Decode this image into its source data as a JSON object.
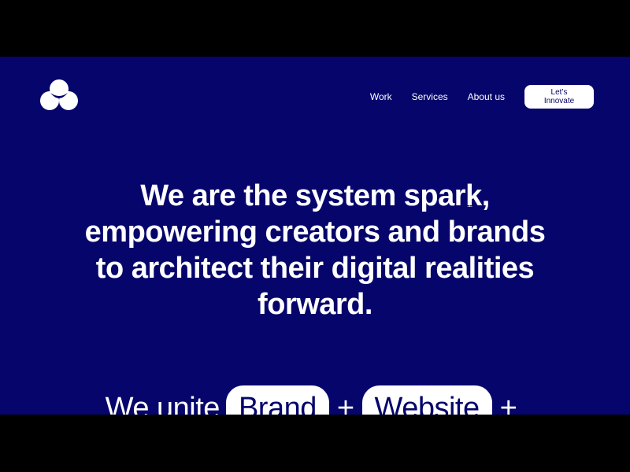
{
  "nav": {
    "links": [
      "Work",
      "Services",
      "About us"
    ],
    "cta_label": "Let’s Innovate"
  },
  "hero": {
    "line1": "We are the system spark,",
    "line2": "empowering creators and brands",
    "line3": "to architect their digital realities",
    "line4": "forward."
  },
  "unite": {
    "lead": "We unite",
    "pill1": "Brand",
    "plus": "+",
    "pill2": "Website",
    "plus2": "+"
  },
  "colors": {
    "background": "#05056b",
    "text": "#ffffff",
    "letterbox": "#000000"
  },
  "icons": {
    "logo": "three-circle-logo-icon",
    "cursor": "text-cursor-icon"
  }
}
